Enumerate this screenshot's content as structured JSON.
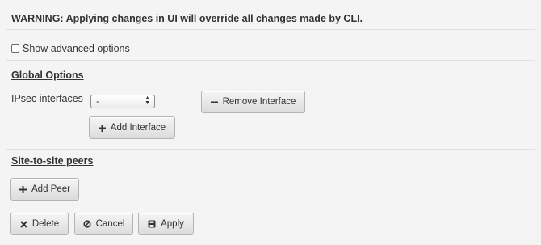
{
  "warning": "WARNING: Applying changes in UI will override all changes made by CLI.",
  "advanced": {
    "label": "Show advanced options",
    "checked": false
  },
  "global_options": {
    "title": "Global Options",
    "ipsec_label": "IPsec interfaces",
    "ipsec_selected": "-",
    "remove_interface_label": "Remove Interface",
    "add_interface_label": "Add Interface"
  },
  "site_to_site": {
    "title": "Site-to-site peers",
    "add_peer_label": "Add Peer"
  },
  "actions": {
    "delete_label": "Delete",
    "cancel_label": "Cancel",
    "apply_label": "Apply"
  }
}
